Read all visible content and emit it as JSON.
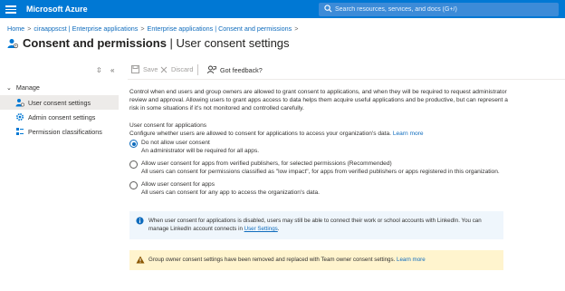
{
  "topbar": {
    "brand": "Microsoft Azure",
    "search_placeholder": "Search resources, services, and docs (G+/)"
  },
  "breadcrumb": [
    "Home",
    "ciraappscst | Enterprise applications",
    "Enterprise applications | Consent and permissions"
  ],
  "title": {
    "main": "Consent and permissions",
    "sub": " | User consent settings",
    "more": "···"
  },
  "nav": {
    "group": "Manage",
    "items": [
      {
        "label": "User consent settings",
        "icon": "user-settings-icon",
        "active": true
      },
      {
        "label": "Admin consent settings",
        "icon": "gear-icon",
        "active": false
      },
      {
        "label": "Permission classifications",
        "icon": "classification-icon",
        "active": false
      }
    ]
  },
  "toolbar": {
    "save": "Save",
    "discard": "Discard",
    "feedback": "Got feedback?"
  },
  "intro": "Control when end users and group owners are allowed to grant consent to applications, and when they will be required to request administrator review and approval. Allowing users to grant apps access to data helps them acquire useful applications and be productive, but can represent a risk in some situations if it's not monitored and controlled carefully.",
  "section": {
    "label": "User consent for applications",
    "desc": "Configure whether users are allowed to consent for applications to access your organization's data.",
    "learn_more": "Learn more"
  },
  "options": [
    {
      "title": "Do not allow user consent",
      "sub": "An administrator will be required for all apps.",
      "checked": true
    },
    {
      "title": "Allow user consent for apps from verified publishers, for selected permissions (Recommended)",
      "sub": "All users can consent for permissions classified as \"low impact\", for apps from verified publishers or apps registered in this organization.",
      "checked": false
    },
    {
      "title": "Allow user consent for apps",
      "sub": "All users can consent for any app to access the organization's data.",
      "checked": false
    }
  ],
  "info_banner": {
    "text": "When user consent for applications is disabled, users may still be able to connect their work or school accounts with LinkedIn. You can manage LinkedIn account connects in ",
    "link": "User Settings",
    "tail": "."
  },
  "warn_banner": {
    "text": "Group owner consent settings have been removed and replaced with Team owner consent settings. ",
    "link": "Learn more"
  },
  "colors": {
    "accent": "#0078d4",
    "link": "#0f6cbd",
    "info_bg": "#eff6fc",
    "warn_bg": "#fff4ce",
    "warn_icon": "#8a5600"
  }
}
